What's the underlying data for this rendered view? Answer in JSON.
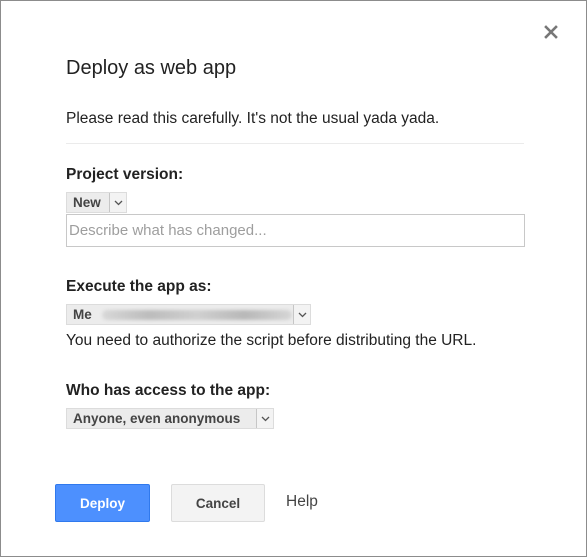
{
  "dialog": {
    "title": "Deploy as web app",
    "intro": "Please read this carefully. It's not the usual yada yada."
  },
  "project_version": {
    "label": "Project version:",
    "selected": "New",
    "description_placeholder": "Describe what has changed...",
    "description_value": ""
  },
  "execute_as": {
    "label": "Execute the app as:",
    "selected": "Me",
    "note": "You need to authorize the script before distributing the URL."
  },
  "access": {
    "label": "Who has access to the app:",
    "selected": "Anyone, even anonymous"
  },
  "buttons": {
    "deploy": "Deploy",
    "cancel": "Cancel",
    "help": "Help"
  },
  "icons": {
    "close": "close-icon",
    "dropdown": "chevron-down-icon"
  },
  "colors": {
    "primary": "#4d90fe",
    "text": "#222222",
    "placeholder": "#9e9e9e"
  }
}
